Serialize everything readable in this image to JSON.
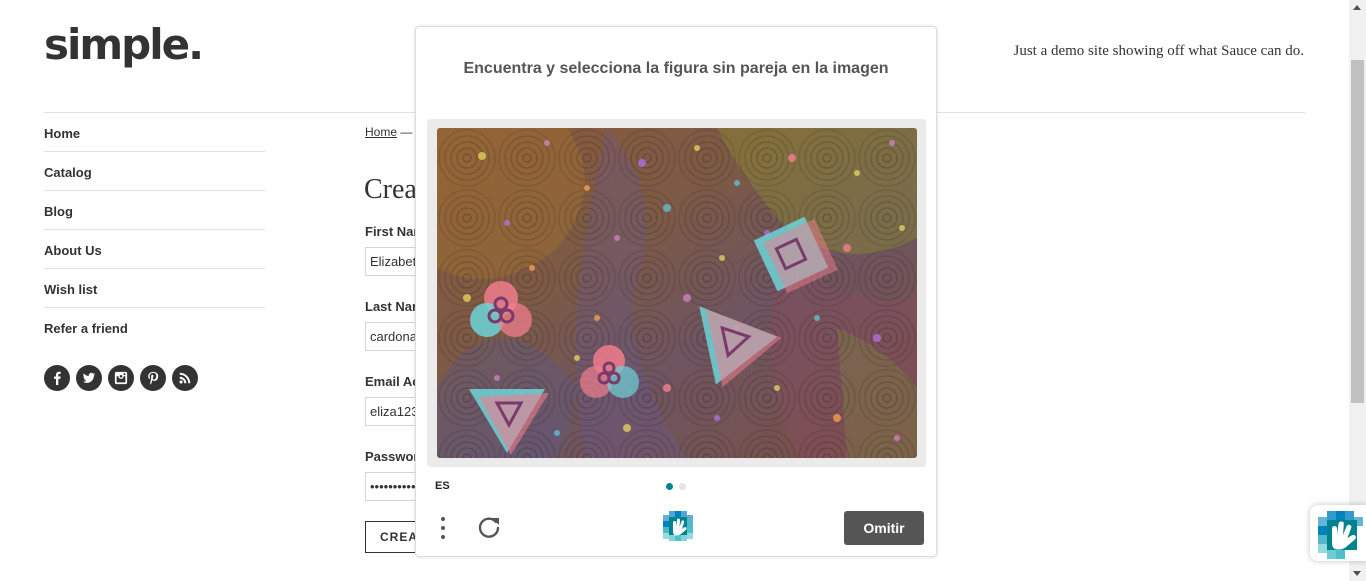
{
  "site": {
    "logo": "simple.",
    "tagline": "Just a demo site showing off what Sauce can do."
  },
  "sidebar": {
    "items": [
      {
        "label": "Home"
      },
      {
        "label": "Catalog"
      },
      {
        "label": "Blog"
      },
      {
        "label": "About Us"
      },
      {
        "label": "Wish list"
      },
      {
        "label": "Refer a friend"
      }
    ],
    "social": [
      "facebook-icon",
      "twitter-icon",
      "instagram-icon",
      "pinterest-icon",
      "rss-icon"
    ]
  },
  "main": {
    "breadcrumb": {
      "home": "Home",
      "separator": "—"
    },
    "title": "Crea",
    "fields": [
      {
        "label": "First Nar",
        "value": "Elizabet"
      },
      {
        "label": "Last Nan",
        "value": "cardona"
      },
      {
        "label": "Email Ac",
        "value": "eliza123"
      },
      {
        "label": "Passwor",
        "value": "••••••••••"
      }
    ],
    "submit_label": "CREA"
  },
  "captcha": {
    "prompt": "Encuentra y selecciona la figura sin pareja en la imagen",
    "language": "ES",
    "skip_label": "Omitir",
    "pages": 2,
    "active_page": 1,
    "colors": {
      "accent": "#00838f",
      "button": "#555555",
      "shape_pink": "#f07d8c",
      "shape_cyan": "#6fd3d8"
    }
  }
}
